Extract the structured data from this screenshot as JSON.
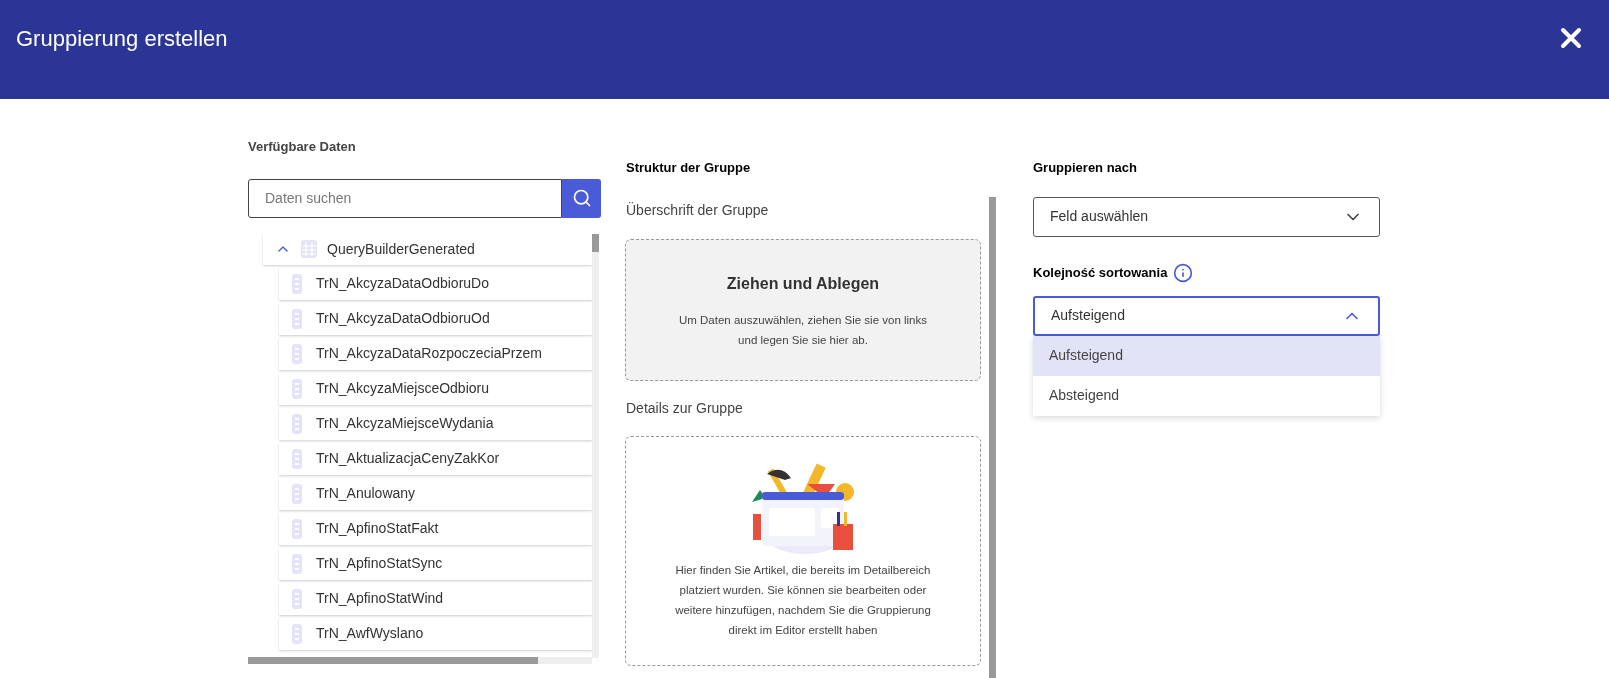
{
  "dialog": {
    "title": "Gruppierung erstellen"
  },
  "available_data": {
    "heading": "Verfügbare Daten",
    "search": {
      "placeholder": "Daten suchen"
    },
    "tree": [
      {
        "label": "QueryBuilderGenerated",
        "expanded": true,
        "children": [
          {
            "label": "TrN_AkcyzaDataOdbioruDo"
          },
          {
            "label": "TrN_AkcyzaDataOdbioruOd"
          },
          {
            "label": "TrN_AkcyzaDataRozpoczeciaPrzem"
          },
          {
            "label": "TrN_AkcyzaMiejsceOdbioru"
          },
          {
            "label": "TrN_AkcyzaMiejsceWydania"
          },
          {
            "label": "TrN_AktualizacjaCenyZakKor"
          },
          {
            "label": "TrN_Anulowany"
          },
          {
            "label": "TrN_ApfinoStatFakt"
          },
          {
            "label": "TrN_ApfinoStatSync"
          },
          {
            "label": "TrN_ApfinoStatWind"
          },
          {
            "label": "TrN_AwfWyslano"
          }
        ]
      }
    ]
  },
  "structure": {
    "heading": "Struktur der Gruppe",
    "header_section": {
      "label": "Überschrift der Gruppe",
      "drop_title": "Ziehen und Ablegen",
      "drop_text": "Um Daten auszuwählen, ziehen Sie sie von links und legen Sie sie hier ab."
    },
    "details_section": {
      "label": "Details zur Gruppe",
      "text": "Hier finden Sie Artikel, die bereits im Detailbereich platziert wurden. Sie können sie bearbeiten oder weitere hinzufügen, nachdem Sie die Gruppierung direkt im Editor erstellt haben"
    }
  },
  "group_by": {
    "heading": "Gruppieren nach",
    "select": {
      "value": "Feld auswählen",
      "open": false
    }
  },
  "sort_order": {
    "heading": "Kolejność sortowania",
    "select": {
      "value": "Aufsteigend",
      "open": true
    },
    "options": [
      {
        "label": "Aufsteigend",
        "selected": true
      },
      {
        "label": "Absteigend",
        "selected": false
      }
    ]
  }
}
